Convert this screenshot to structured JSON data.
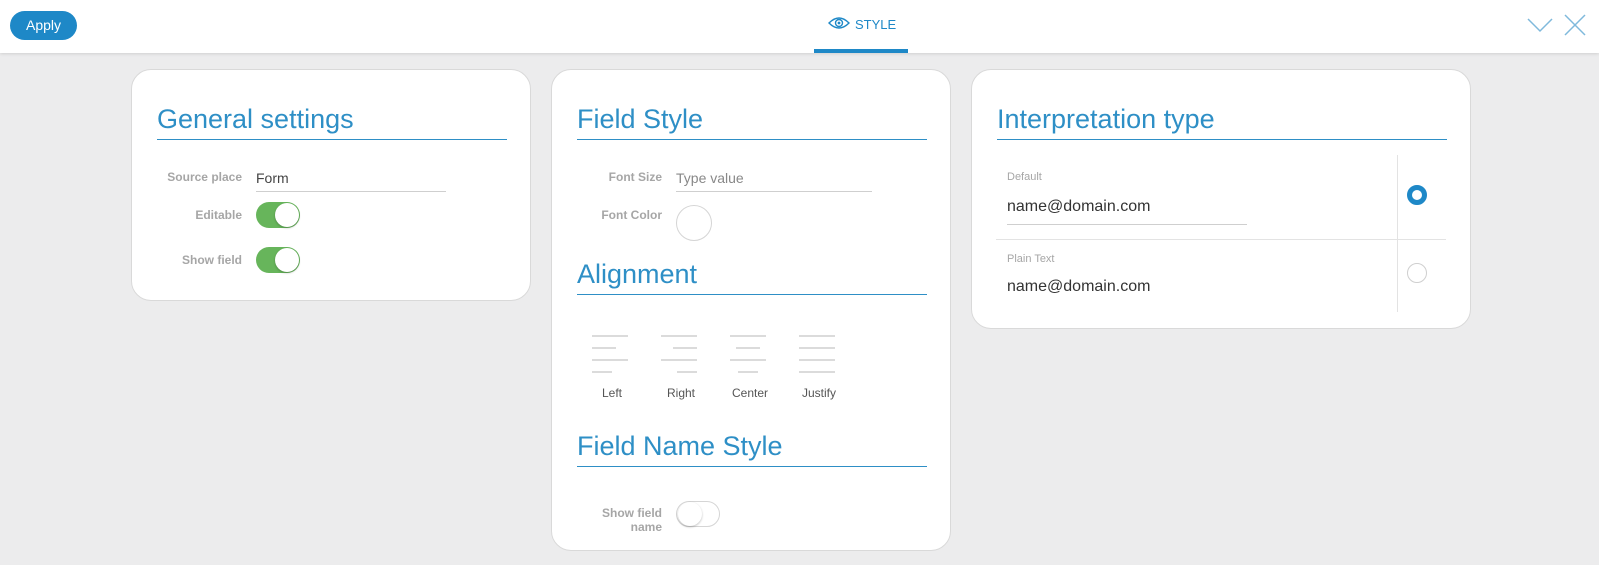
{
  "toolbar": {
    "apply_label": "Apply",
    "active_tab": {
      "label": "STYLE",
      "icon": "eye-icon"
    },
    "right_icons": [
      "chevron-down-icon",
      "close-icon"
    ]
  },
  "colors": {
    "accent": "#1e88c7",
    "toggle_on": "#67b55b",
    "background": "#ececed"
  },
  "general_settings": {
    "title": "General settings",
    "source_place": {
      "label": "Source place",
      "value": "Form"
    },
    "editable": {
      "label": "Editable",
      "on": true
    },
    "show_field": {
      "label": "Show field",
      "on": true
    }
  },
  "field_style": {
    "title": "Field Style",
    "font_size": {
      "label": "Font Size",
      "placeholder": "Type value",
      "value": ""
    },
    "font_color": {
      "label": "Font Color"
    },
    "alignment": {
      "title": "Alignment",
      "options": [
        {
          "label": "Left",
          "icon": "align-left-icon"
        },
        {
          "label": "Right",
          "icon": "align-right-icon"
        },
        {
          "label": "Center",
          "icon": "align-center-icon"
        },
        {
          "label": "Justify",
          "icon": "align-justify-icon"
        }
      ]
    },
    "field_name_style": {
      "title": "Field Name Style",
      "show_field_name": {
        "label_line1": "Show field",
        "label_line2": "name",
        "on": false
      }
    }
  },
  "interpretation_type": {
    "title": "Interpretation type",
    "options": [
      {
        "label": "Default",
        "value": "name@domain.com",
        "selected": true
      },
      {
        "label": "Plain Text",
        "value": "name@domain.com",
        "selected": false
      }
    ]
  }
}
